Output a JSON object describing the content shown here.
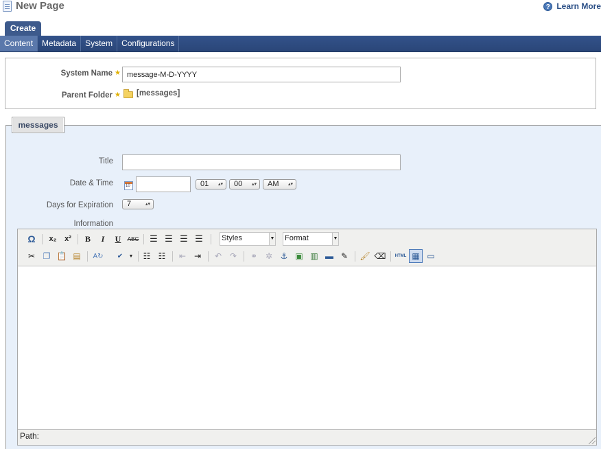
{
  "header": {
    "title": "New Page",
    "learn_more": "Learn More",
    "help_icon": "?"
  },
  "tabs": {
    "create": "Create",
    "subnav": [
      "Content",
      "Metadata",
      "System",
      "Configurations"
    ]
  },
  "system": {
    "system_name_label": "System Name",
    "system_name_value": "message-M-D-YYYY",
    "parent_folder_label": "Parent Folder",
    "parent_folder_value": "[messages]"
  },
  "messages": {
    "legend": "messages",
    "title_label": "Title",
    "title_value": "",
    "datetime_label": "Date & Time",
    "date_value": "",
    "hour": "01",
    "minute": "00",
    "ampm": "AM",
    "expiration_label": "Days for Expiration",
    "expiration_value": "7",
    "information_label": "Information"
  },
  "editor": {
    "styles_select": "Styles",
    "format_select": "Format",
    "path_label": "Path:",
    "toolbar_glyphs": {
      "special_char": "Ω",
      "subscript": "x₂",
      "superscript": "x²",
      "bold": "B",
      "italic": "I",
      "underline": "U",
      "strike": "ABC",
      "html": "HTML"
    }
  },
  "colors": {
    "nav_bar": "#2a4678",
    "active_tab": "#3d5a8c",
    "panel_bg": "#e8f0fa",
    "required_star": "#e0b000"
  }
}
